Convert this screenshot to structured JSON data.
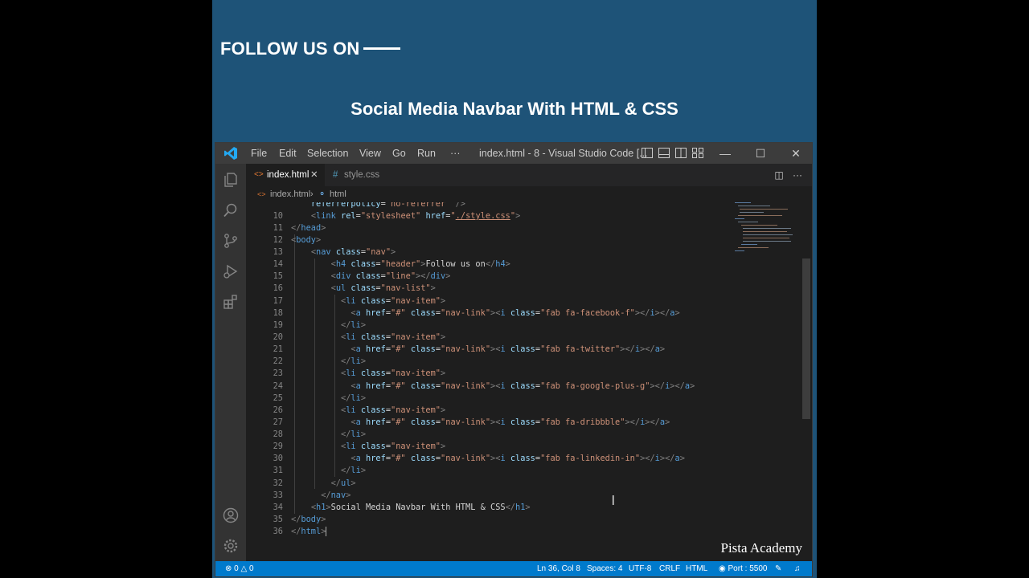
{
  "preview": {
    "follow_text": "FOLLOW US ON",
    "title": "Social Media Navbar With HTML & CSS"
  },
  "titlebar": {
    "menus": [
      "File",
      "Edit",
      "Selection",
      "View",
      "Go",
      "Run",
      "···"
    ],
    "window_title": "index.html - 8 - Visual Studio Code [..."
  },
  "tabs": [
    {
      "label": "index.html",
      "active": true,
      "icon": "html-file-icon"
    },
    {
      "label": "style.css",
      "active": false,
      "icon": "css-file-icon"
    }
  ],
  "breadcrumb": {
    "file": "index.html",
    "element": "html"
  },
  "code": {
    "line_numbers": [
      "10",
      "11",
      "12",
      "13",
      "14",
      "15",
      "16",
      "17",
      "18",
      "19",
      "20",
      "21",
      "22",
      "23",
      "24",
      "25",
      "26",
      "27",
      "28",
      "29",
      "30",
      "31",
      "32",
      "33",
      "34",
      "35",
      "36"
    ],
    "top_partial": "referrerpolicy=\"no-referrer\" />"
  },
  "statusbar": {
    "errors": "0",
    "warnings": "0",
    "position": "Ln 36, Col 8",
    "spaces": "Spaces: 4",
    "encoding": "UTF-8",
    "eol": "CRLF",
    "language": "HTML",
    "port": "Port : 5500"
  },
  "watermark": "Pista Academy",
  "colors": {
    "background": "#1e5378",
    "statusbar": "#007acc",
    "tag": "#569cd6",
    "attr": "#9cdcfe",
    "string": "#ce9178"
  }
}
